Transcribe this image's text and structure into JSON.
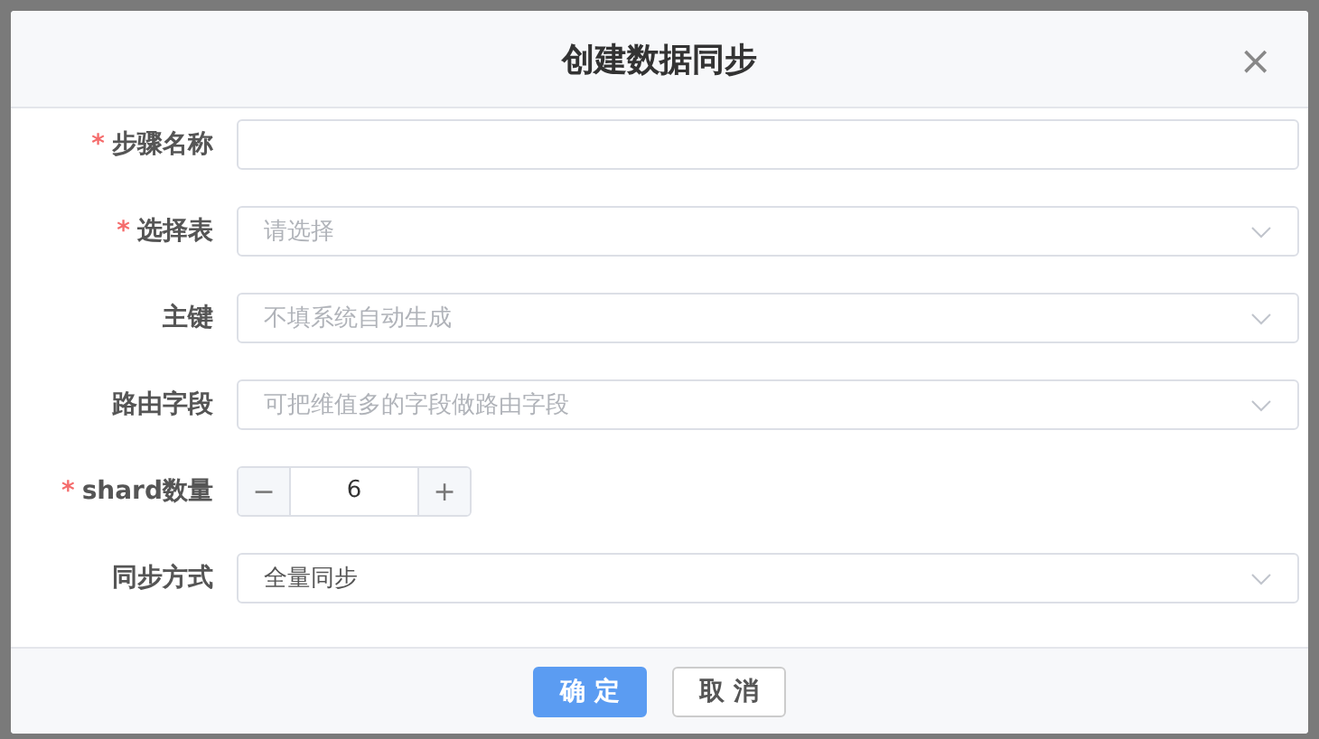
{
  "dialog": {
    "title": "创建数据同步",
    "close_symbol": "×"
  },
  "fields": [
    {
      "kind": "text",
      "label": "步骤名称",
      "required_mark": "*"
    },
    {
      "kind": "select",
      "label": "选择表",
      "required_mark": "*",
      "placeholder": "请选择"
    },
    {
      "kind": "select",
      "label": "主键",
      "placeholder": "不填系统自动生成"
    },
    {
      "kind": "select",
      "label": "路由字段",
      "placeholder": "可把维值多的字段做路由字段"
    },
    {
      "kind": "number",
      "label": "shard数量",
      "required_mark": "*",
      "value": "6",
      "minus": "−",
      "plus": "+"
    },
    {
      "kind": "select",
      "label": "同步方式",
      "value": "全量同步"
    }
  ],
  "buttons": [
    {
      "label": "确 定",
      "primary": true
    },
    {
      "label": "取 消",
      "primary": false
    }
  ]
}
